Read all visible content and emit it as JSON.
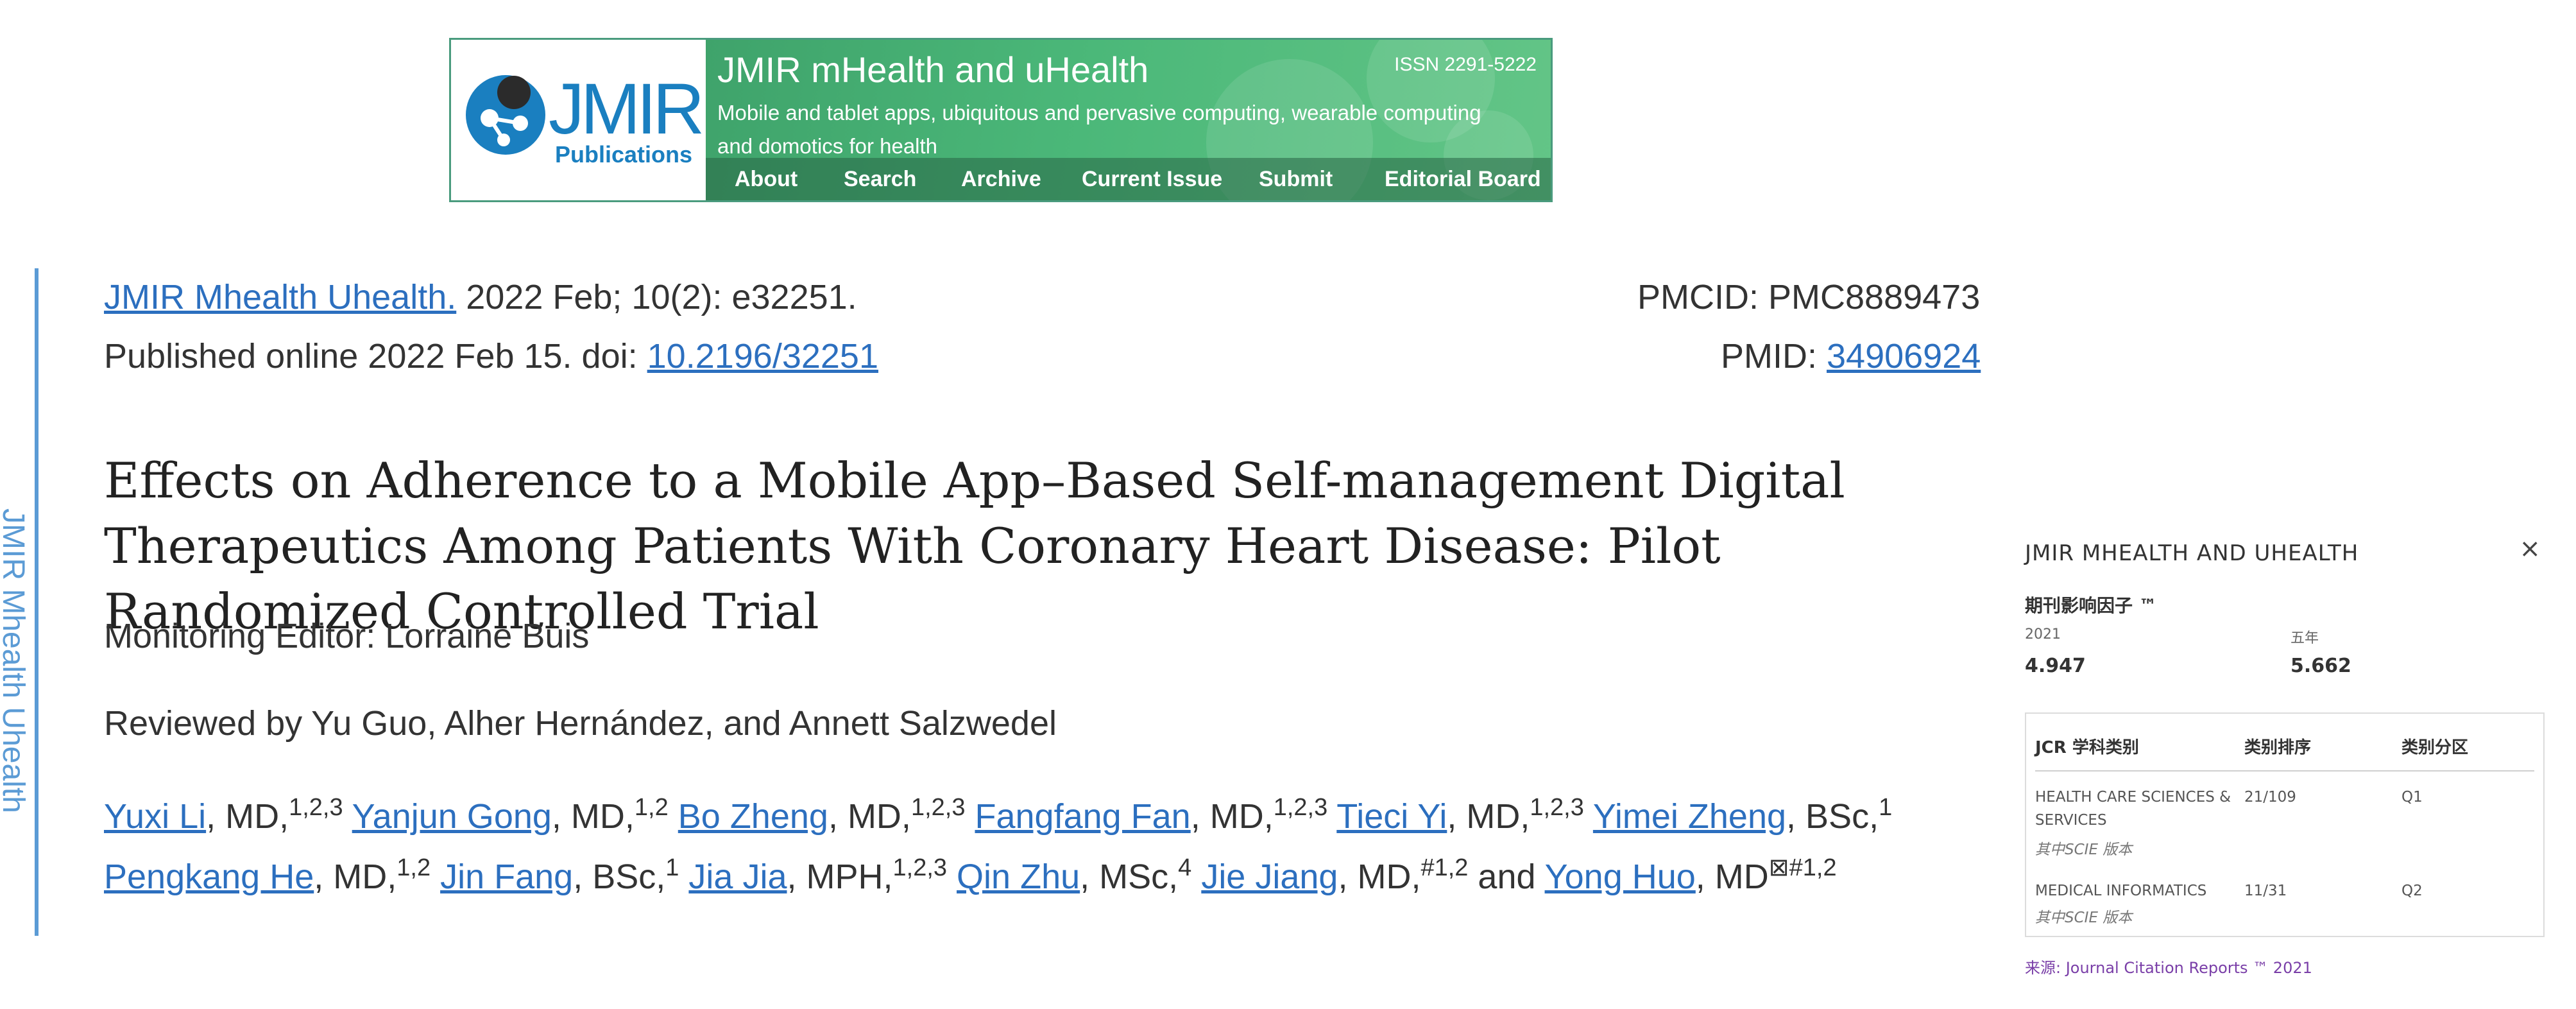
{
  "banner": {
    "logo_text": "JMIR",
    "logo_sub": "Publications",
    "journal_title": "JMIR mHealth and uHealth",
    "issn": "ISSN 2291-5222",
    "description": "Mobile and tablet apps, ubiquitous and pervasive computing, wearable computing and domotics for health",
    "nav": [
      "About",
      "Search",
      "Archive",
      "Current Issue",
      "Submit",
      "Editorial Board"
    ],
    "colors": {
      "green": "#4bb879",
      "border": "#4a9b7e",
      "logo_blue": "#1a7fc0"
    }
  },
  "sidebar": {
    "journal_name": "JMIR Mhealth Uhealth"
  },
  "citation": {
    "journal_link": "JMIR Mhealth Uhealth.",
    "issue": " 2022 Feb; 10(2): e32251.",
    "published_prefix": "Published online 2022 Feb 15. doi: ",
    "doi": "10.2196/32251",
    "pmcid_label": "PMCID: PMC8889473",
    "pmid_label": "PMID: ",
    "pmid": "34906924"
  },
  "article": {
    "title": "Effects on Adherence to a Mobile App–Based Self-management Digital Therapeutics Among Patients With Coronary Heart Disease: Pilot Randomized Controlled Trial",
    "monitoring_editor": "Monitoring Editor: Lorraine Buis",
    "reviewed_by": "Reviewed by Yu Guo, Alher Hernández, and Annett Salzwedel"
  },
  "authors": [
    {
      "name": "Yuxi Li",
      "degree": ", MD,",
      "aff": "1,2,3"
    },
    {
      "name": "Yanjun Gong",
      "degree": ", MD,",
      "aff": "1,2"
    },
    {
      "name": "Bo Zheng",
      "degree": ", MD,",
      "aff": "1,2,3"
    },
    {
      "name": "Fangfang Fan",
      "degree": ", MD,",
      "aff": "1,2,3"
    },
    {
      "name": "Tieci Yi",
      "degree": ", MD,",
      "aff": "1,2,3"
    },
    {
      "name": "Yimei Zheng",
      "degree": ", BSc,",
      "aff": "1"
    },
    {
      "name": "Pengkang He",
      "degree": ", MD,",
      "aff": "1,2"
    },
    {
      "name": "Jin Fang",
      "degree": ", BSc,",
      "aff": "1"
    },
    {
      "name": "Jia Jia",
      "degree": ", MPH,",
      "aff": "1,2,3"
    },
    {
      "name": "Qin Zhu",
      "degree": ", MSc,",
      "aff": "4"
    },
    {
      "name": "Jie Jiang",
      "degree": ", MD,",
      "aff": "#1,2"
    },
    {
      "name": "Yong Huo",
      "degree": ", MD",
      "aff": "⊠#1,2"
    }
  ],
  "authors_conjunction": " and ",
  "jcr_panel": {
    "header": "JMIR MHEALTH AND UHEALTH",
    "close": "×",
    "impact_label": "期刊影响因子 ™",
    "year_label": "2021",
    "five_year_label": "五年",
    "impact_value": "4.947",
    "five_year_value": "5.662",
    "columns": [
      "JCR 学科类别",
      "类别排序",
      "类别分区"
    ],
    "rows": [
      {
        "category": "HEALTH CARE SCIENCES & SERVICES",
        "rank": "21/109",
        "quartile": "Q1",
        "edition": "其中SCIE 版本"
      },
      {
        "category": "MEDICAL INFORMATICS",
        "rank": "11/31",
        "quartile": "Q2",
        "edition": "其中SCIE 版本"
      }
    ],
    "source": "来源: Journal Citation Reports ™ 2021"
  }
}
